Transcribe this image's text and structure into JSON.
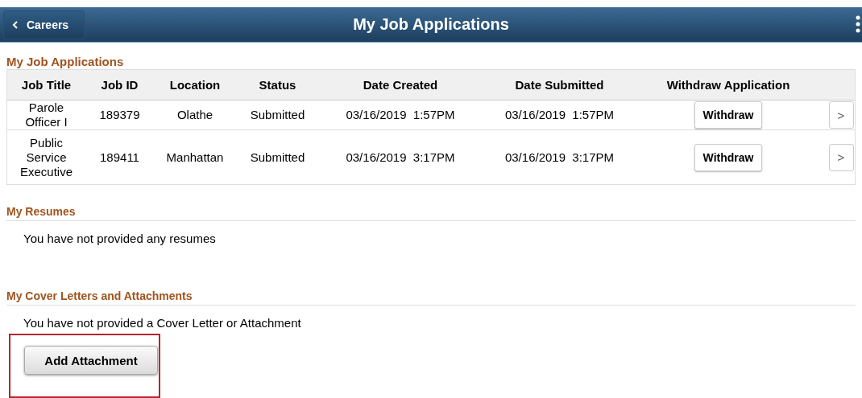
{
  "header": {
    "back_button": "Careers",
    "title": "My Job Applications"
  },
  "applications": {
    "heading": "My Job Applications",
    "columns": [
      "Job Title",
      "Job ID",
      "Location",
      "Status",
      "Date Created",
      "Date Submitted",
      "Withdraw Application"
    ],
    "rows": [
      {
        "job_title": "Parole Officer I",
        "job_id": "189379",
        "location": "Olathe",
        "status": "Submitted",
        "date_created": "03/16/2019  1:57PM",
        "date_submitted": "03/16/2019  1:57PM",
        "action": "Withdraw",
        "detail": ">"
      },
      {
        "job_title": "Public Service Executive",
        "job_id": "189411",
        "location": "Manhattan",
        "status": "Submitted",
        "date_created": "03/16/2019  3:17PM",
        "date_submitted": "03/16/2019  3:17PM",
        "action": "Withdraw",
        "detail": ">"
      }
    ]
  },
  "resumes": {
    "heading": "My Resumes",
    "message": "You have not provided any resumes"
  },
  "cover_letters": {
    "heading": "My Cover Letters and Attachments",
    "message": "You have not provided a Cover Letter or Attachment",
    "button": "Add Attachment"
  }
}
